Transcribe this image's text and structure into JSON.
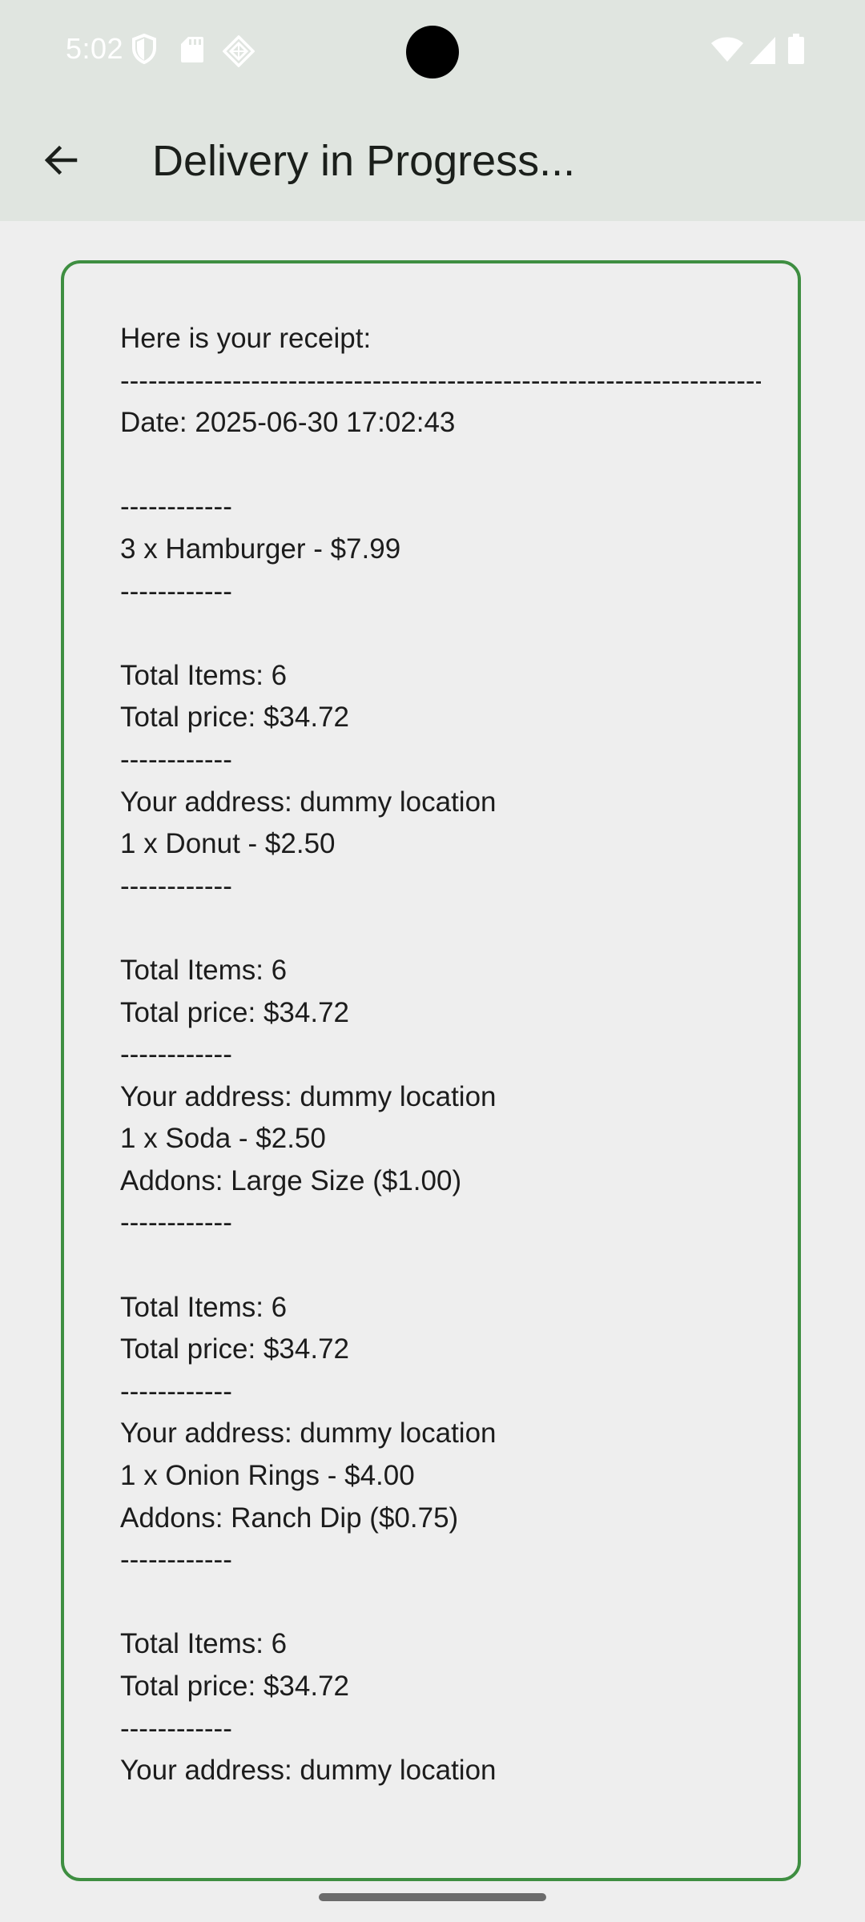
{
  "status_bar": {
    "time": "5:02",
    "left_icons": [
      "shield-icon",
      "sd-card-icon",
      "diamond-icon"
    ],
    "right_icons": [
      "wifi-icon",
      "signal-icon",
      "battery-icon"
    ]
  },
  "app_bar": {
    "back_icon": "arrow-left-icon",
    "title": "Delivery in Progress..."
  },
  "receipt": {
    "lines": [
      "Here is your receipt:",
      "-----------------------------------------------------------------------",
      "Date: 2025-06-30 17:02:43",
      "",
      "------------",
      "3 x Hamburger - $7.99",
      "------------",
      "",
      "Total Items: 6",
      "Total price: $34.72",
      "------------",
      "Your address: dummy location",
      "1 x Donut - $2.50",
      "------------",
      "",
      "Total Items: 6",
      "Total price: $34.72",
      "------------",
      "Your address: dummy location",
      "1 x Soda - $2.50",
      "Addons: Large Size ($1.00)",
      "------------",
      "",
      "Total Items: 6",
      "Total price: $34.72",
      "------------",
      "Your address: dummy location",
      "1 x Onion Rings - $4.00",
      "Addons: Ranch Dip ($0.75)",
      "------------",
      "",
      "Total Items: 6",
      "Total price: $34.72",
      "------------",
      "Your address: dummy location"
    ]
  },
  "colors": {
    "app_bar_bg": "#e0e5e0",
    "page_bg": "#eeeeee",
    "card_border": "#3e8e41"
  }
}
